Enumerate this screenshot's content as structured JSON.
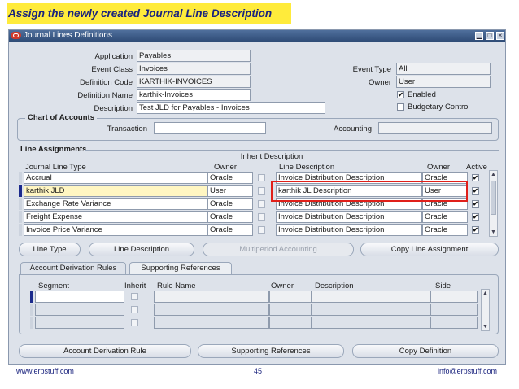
{
  "slide": {
    "title": "Assign the newly created Journal Line Description",
    "footer_left": "www.erpstuff.com",
    "page_number": "45",
    "footer_right": "info@erpstuff.com"
  },
  "window": {
    "title": "Journal Lines Definitions",
    "minimize_glyph": "▁",
    "maximize_glyph": "□",
    "close_glyph": "×"
  },
  "header": {
    "application_label": "Application",
    "application_value": "Payables",
    "event_class_label": "Event Class",
    "event_class_value": "Invoices",
    "definition_code_label": "Definition Code",
    "definition_code_value": "KARTHIK-INVOICES",
    "definition_name_label": "Definition Name",
    "definition_name_value": "karthik-Invoices",
    "description_label": "Description",
    "description_value": "Test JLD for Payables - Invoices",
    "event_type_label": "Event Type",
    "event_type_value": "All",
    "owner_label": "Owner",
    "owner_value": "User",
    "enabled_label": "Enabled",
    "enabled_checked": true,
    "budgetary_label": "Budgetary Control",
    "budgetary_checked": false
  },
  "chart_of_accounts": {
    "title": "Chart of Accounts",
    "transaction_label": "Transaction",
    "transaction_value": "",
    "accounting_label": "Accounting",
    "accounting_value": ""
  },
  "line_assignments": {
    "title": "Line Assignments",
    "inherit_description_header": "Inherit Description",
    "columns": {
      "jlt": "Journal Line Type",
      "owner": "Owner",
      "line_description": "Line Description",
      "desc_owner": "Owner",
      "active": "Active"
    },
    "rows": [
      {
        "jlt": "Accrual",
        "owner": "Oracle",
        "inherit": false,
        "desc": "Invoice Distribution Description",
        "desc_owner": "Oracle",
        "active": true
      },
      {
        "jlt": "karthik JLD",
        "owner": "User",
        "inherit": false,
        "desc": "karthik JL Description",
        "desc_owner": "User",
        "active": true
      },
      {
        "jlt": "Exchange Rate Variance",
        "owner": "Oracle",
        "inherit": false,
        "desc": "Invoice Distribution Description",
        "desc_owner": "Oracle",
        "active": true
      },
      {
        "jlt": "Freight Expense",
        "owner": "Oracle",
        "inherit": false,
        "desc": "Invoice Distribution Description",
        "desc_owner": "Oracle",
        "active": true
      },
      {
        "jlt": "Invoice Price Variance",
        "owner": "Oracle",
        "inherit": false,
        "desc": "Invoice Distribution Description",
        "desc_owner": "Oracle",
        "active": true
      }
    ],
    "selected_row": 1,
    "buttons": {
      "line_type": "Line Type",
      "line_description": "Line Description",
      "multiperiod": "Multiperiod Accounting",
      "copy_line": "Copy Line Assignment"
    }
  },
  "tabs": {
    "account_derivation": "Account Derivation Rules",
    "supporting_references": "Supporting References"
  },
  "derivation_grid": {
    "columns": {
      "segment": "Segment",
      "inherit": "Inherit",
      "rule_name": "Rule Name",
      "owner": "Owner",
      "description": "Description",
      "side": "Side"
    }
  },
  "bottom_buttons": {
    "account_derivation_rule": "Account Derivation Rule",
    "supporting_references": "Supporting References",
    "copy_definition": "Copy Definition"
  },
  "colors": {
    "highlight_box": "#e0201a",
    "title_banner": "#ffeb3b",
    "title_text": "#1a237e",
    "window_bg": "#dde2ea",
    "titlebar": "#2f4c77",
    "selected_field": "#fff6c2"
  },
  "icons": {
    "window_logo": "oracle-logo-icon",
    "check": "checkmark-icon",
    "scroll_up": "arrow-up-icon",
    "scroll_down": "arrow-down-icon"
  }
}
